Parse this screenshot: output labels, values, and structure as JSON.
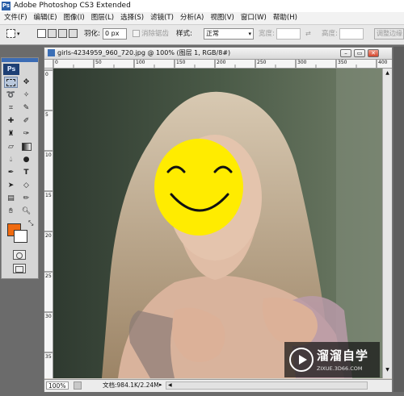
{
  "window": {
    "title": "Adobe Photoshop CS3 Extended",
    "app_icon": "Ps"
  },
  "menu": [
    "文件(F)",
    "编辑(E)",
    "图像(I)",
    "图层(L)",
    "选择(S)",
    "滤镜(T)",
    "分析(A)",
    "视图(V)",
    "窗口(W)",
    "帮助(H)"
  ],
  "options": {
    "feather_label": "羽化:",
    "feather_value": "0 px",
    "antialias_label": "消除锯齿",
    "style_label": "样式:",
    "style_value": "正常",
    "width_label": "宽度:",
    "height_label": "高度:",
    "refine_label": "调整边缘"
  },
  "tools": {
    "logo": "Ps"
  },
  "document": {
    "title": "girls-4234959_960_720.jpg @ 100% (图层 1, RGB/8#)",
    "zoom": "100%",
    "info": "文档:984.1K/2.24M"
  },
  "ruler": {
    "top": [
      "0",
      "50",
      "100",
      "150",
      "200",
      "250",
      "300",
      "350",
      "400"
    ],
    "left": [
      "0",
      "5",
      "10",
      "15",
      "20",
      "25",
      "30",
      "35",
      "40"
    ]
  },
  "watermark": {
    "brand": "溜溜自学",
    "url": "ZIXUE.3D66.COM"
  },
  "colors": {
    "foreground": "#f06a10",
    "background": "#ffffff",
    "smiley": "#ffec00"
  }
}
